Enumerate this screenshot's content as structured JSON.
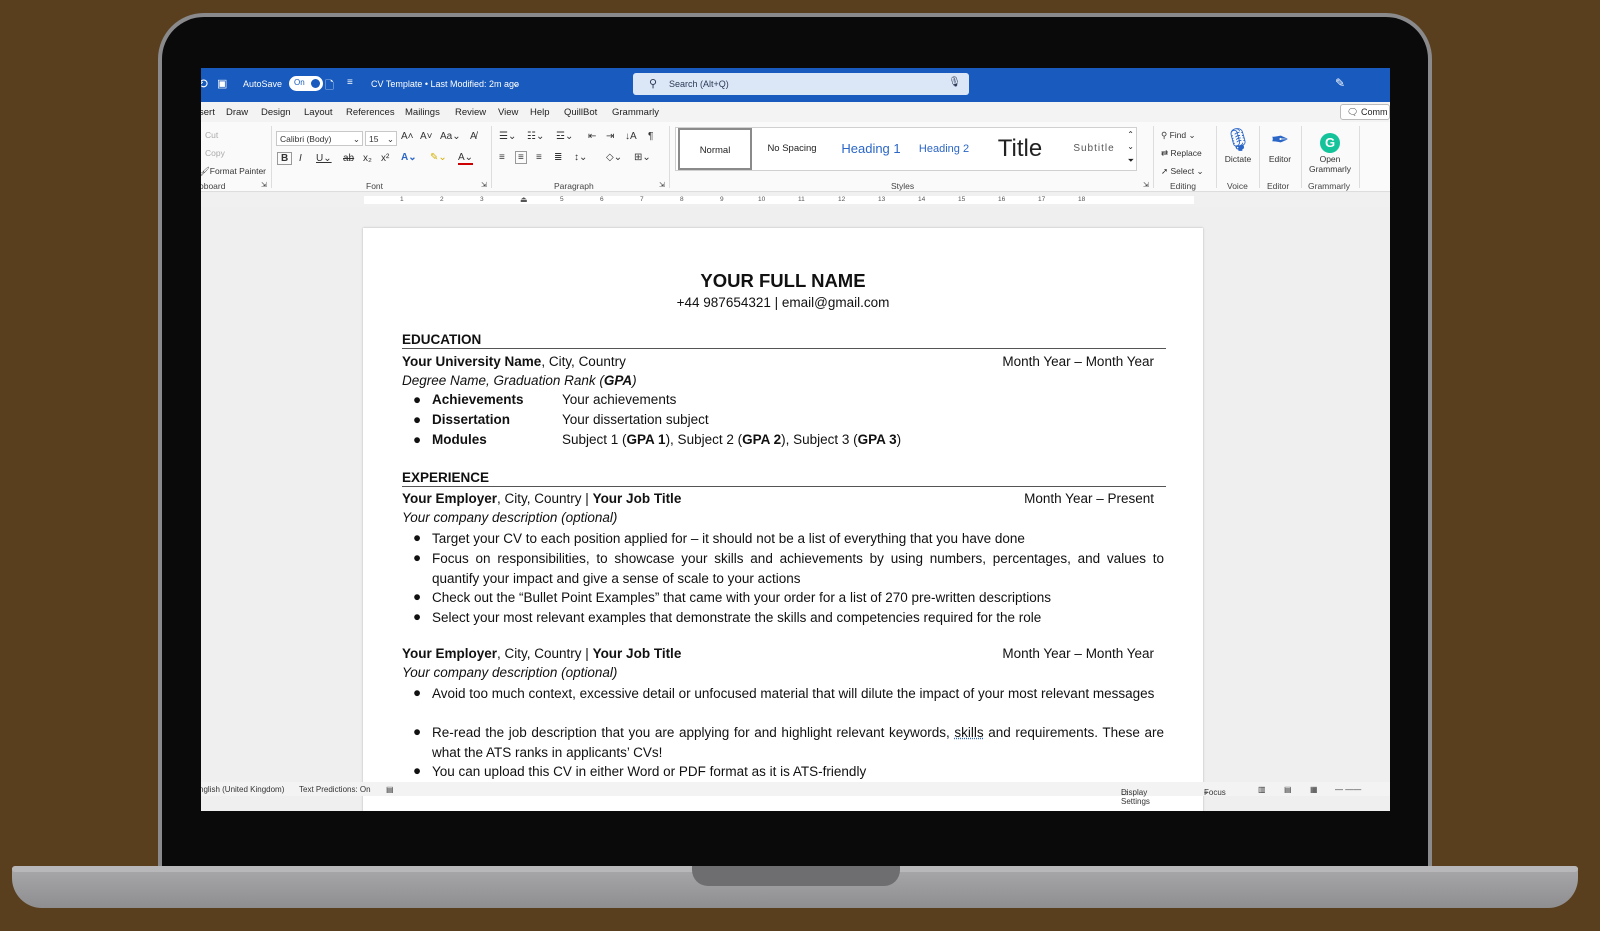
{
  "titlebar": {
    "autosave_label": "AutoSave",
    "autosave_state": "On",
    "doc_title": "CV Template • Last Modified: 2m ago",
    "search_placeholder": "Search (Alt+Q)"
  },
  "menu": {
    "items": [
      "sert",
      "Draw",
      "Design",
      "Layout",
      "References",
      "Mailings",
      "Review",
      "View",
      "Help",
      "QuillBot",
      "Grammarly"
    ],
    "comments": "Comm"
  },
  "ribbon": {
    "clipboard": {
      "cut": "Cut",
      "copy": "Copy",
      "format_painter": "Format Painter",
      "label": "oboard"
    },
    "font": {
      "family": "Calibri (Body)",
      "size": "15",
      "label": "Font"
    },
    "paragraph": {
      "label": "Paragraph"
    },
    "styles": {
      "label": "Styles",
      "items": [
        "Normal",
        "No Spacing",
        "Heading 1",
        "Heading 2",
        "Title",
        "Subtitle"
      ]
    },
    "editing": {
      "find": "Find",
      "replace": "Replace",
      "select": "Select",
      "label": "Editing"
    },
    "voice": {
      "dictate": "Dictate",
      "label": "Voice"
    },
    "editor": {
      "editor": "Editor",
      "label": "Editor"
    },
    "grammarly": {
      "open_line1": "Open",
      "open_line2": "Grammarly",
      "label": "Grammarly"
    }
  },
  "ruler": {
    "ticks": [
      "1",
      "2",
      "3",
      "4",
      "5",
      "6",
      "7",
      "8",
      "9",
      "10",
      "11",
      "12",
      "13",
      "14",
      "15",
      "16",
      "17",
      "18"
    ]
  },
  "document": {
    "name": "YOUR FULL NAME",
    "contact": "+44 987654321 | email@gmail.com",
    "education": {
      "heading": "EDUCATION",
      "university": "Your University Name",
      "university_loc": ", City, Country",
      "dates": "Month Year – Month Year",
      "degree": "Degree Name, Graduation Rank (",
      "degree_gpa": "GPA",
      "degree_end": ")",
      "rows": [
        {
          "label": "Achievements",
          "value": "Your achievements"
        },
        {
          "label": "Dissertation",
          "value": "Your dissertation subject"
        }
      ],
      "modules": {
        "label": "Modules",
        "s1": "Subject 1 (",
        "g1": "GPA 1",
        "s2": "), Subject 2 (",
        "g2": "GPA 2",
        "s3": "), Subject 3 (",
        "g3": "GPA 3",
        "end": ")"
      }
    },
    "experience": {
      "heading": "EXPERIENCE",
      "jobs": [
        {
          "employer": "Your Employer",
          "loc": ", City, Country | ",
          "title": "Your Job Title",
          "dates": "Month Year – Present",
          "desc": "Your company description (optional)",
          "bullets": [
            "Target your CV to each position applied for – it should not be a list of everything that you have done",
            "Focus on responsibilities, to showcase your skills and achievements by using numbers, percentages, and values to quantify your impact and give a sense of scale to your actions",
            "Check out the “Bullet Point Examples” that came with your order for a list of 270 pre-written descriptions",
            "Select your most relevant examples that demonstrate the skills and competencies required for the role"
          ]
        },
        {
          "employer": "Your Employer",
          "loc": ", City, Country | ",
          "title": "Your Job Title",
          "dates": "Month Year – Month Year",
          "desc": "Your company description (optional)",
          "bullets": [
            "Avoid too much context, excessive detail or unfocused material that will dilute the impact of your most relevant messages",
            "Re-read the job description that you are applying for and highlight relevant keywords, ",
            "You can upload this CV in either Word or PDF format as it is ATS-friendly"
          ],
          "bullet2_squiggle": "skills",
          "bullet2_end": " and requirements. These are what the ATS ranks in applicants’ CVs!"
        }
      ]
    }
  },
  "status": {
    "language": "nglish (United Kingdom)",
    "text_predictions": "Text Predictions: On",
    "display_settings": "Display Settings",
    "focus": "Focus"
  }
}
